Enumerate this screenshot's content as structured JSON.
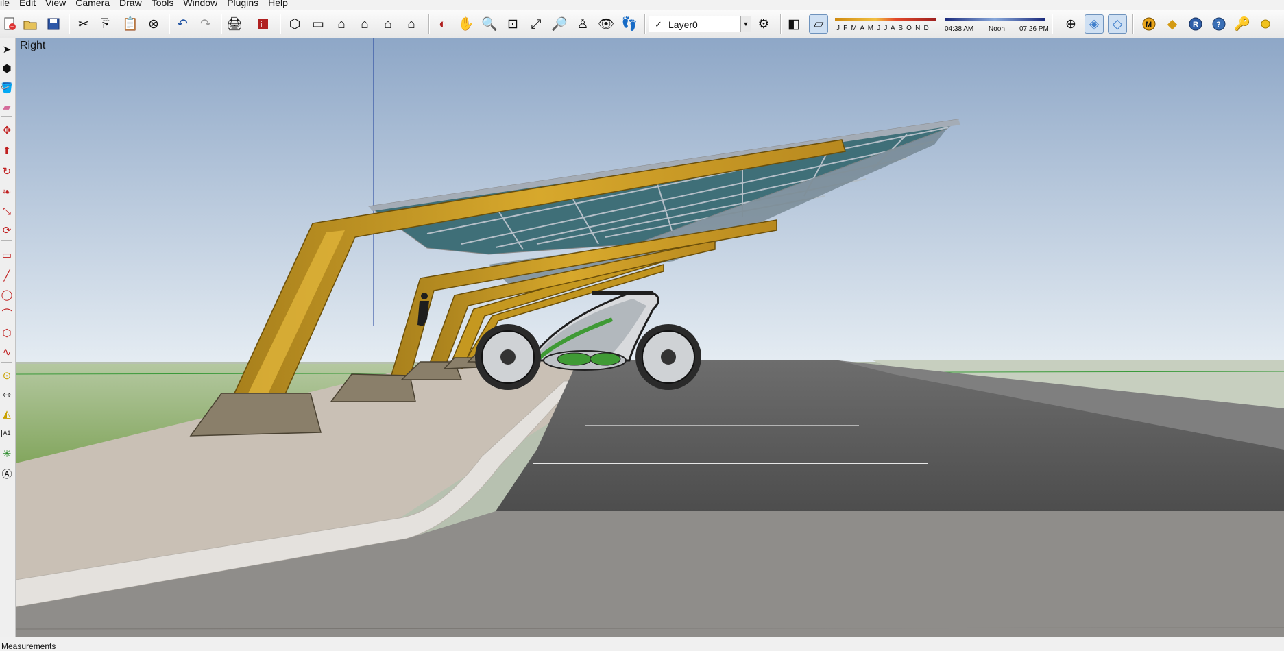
{
  "menu": [
    "ile",
    "Edit",
    "View",
    "Camera",
    "Draw",
    "Tools",
    "Window",
    "Plugins",
    "Help"
  ],
  "toolbar": {
    "icons": [
      "new-icon",
      "open-icon",
      "save-icon",
      "cut-icon",
      "copy-icon",
      "paste-icon",
      "erase-icon",
      "undo-icon",
      "redo-icon",
      "print-icon",
      "model-info-icon",
      "iso-view-icon",
      "top-view-icon",
      "front-view-icon",
      "right-view-icon",
      "back-view-icon",
      "left-view-icon",
      "orbit-icon",
      "pan-icon",
      "zoom-icon",
      "zoom-window-icon",
      "zoom-extents-icon",
      "previous-view-icon",
      "position-camera-icon",
      "look-around-icon",
      "walk-icon"
    ],
    "layer": {
      "selected": "Layer0"
    },
    "shadow": {
      "months": "J F M A M J J A S O N D",
      "time_start": "04:38 AM",
      "time_mid": "Noon",
      "time_end": "07:26 PM"
    },
    "right_icons": [
      "axes-icon",
      "xray-icon",
      "back-edges-icon",
      "m-icon",
      "tag-icon",
      "r-icon",
      "question-icon",
      "key-icon",
      "sun-icon"
    ]
  },
  "left_tools": [
    "select-icon",
    "component-icon",
    "paint-bucket-icon",
    "eraser-icon",
    "move-icon",
    "push-pull-icon",
    "rotate-icon",
    "follow-me-icon",
    "scale-icon",
    "offset-icon",
    "rectangle-icon",
    "line-icon",
    "circle-icon",
    "arc-icon",
    "polygon-icon",
    "freehand-icon",
    "tape-measure-icon",
    "dimension-icon",
    "protractor-icon",
    "text-icon",
    "axes-icon",
    "3d-text-icon"
  ],
  "viewport": {
    "view_name": "Right"
  },
  "status": {
    "text": "Measurements"
  },
  "colors": {
    "sky_top": "#8fa8c8",
    "sky_bottom": "#e6edf3",
    "frame_yellow": "#c49a22",
    "ground_green": "#6fa34a",
    "asphalt": "#5f5f5f",
    "vehicle_green": "#3f9a35"
  }
}
